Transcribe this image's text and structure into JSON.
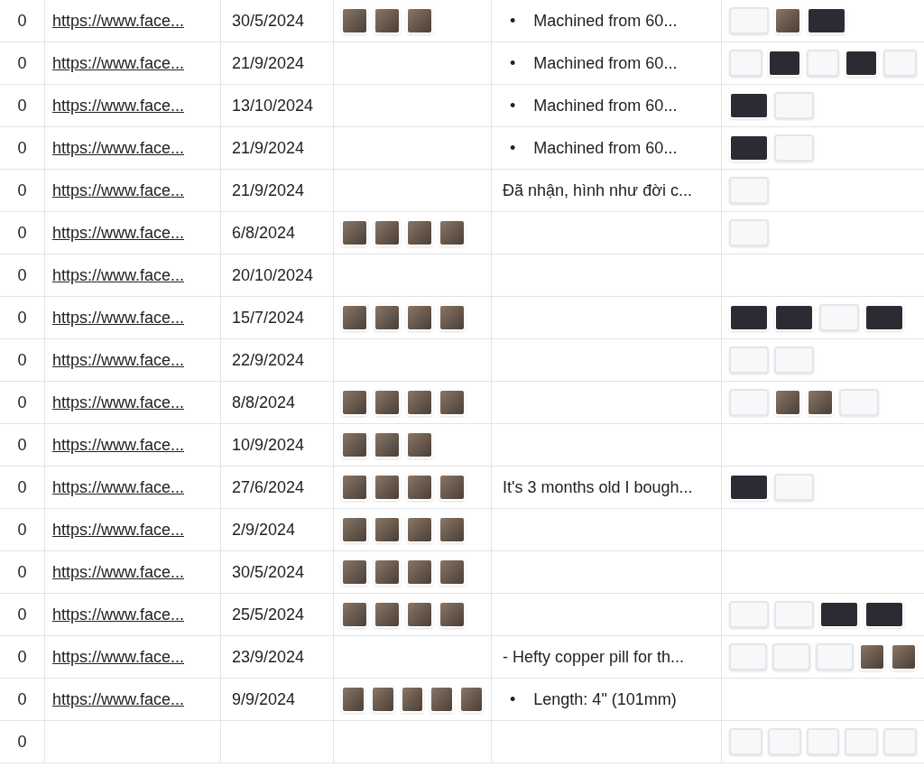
{
  "rows": [
    {
      "count": "0",
      "link": "https://www.face...",
      "date": "30/5/2024",
      "photos": [
        {
          "kind": "photo"
        },
        {
          "kind": "photo"
        },
        {
          "kind": "photo"
        }
      ],
      "bullet": "•",
      "text": "Machined from 60...",
      "attachments": [
        {
          "kind": "document"
        },
        {
          "kind": "photo"
        },
        {
          "kind": "dark"
        }
      ]
    },
    {
      "count": "0",
      "link": "https://www.face...",
      "date": "21/9/2024",
      "photos": [],
      "bullet": "•",
      "text": "Machined from 60...",
      "attachments": [
        {
          "kind": "document"
        },
        {
          "kind": "dark"
        },
        {
          "kind": "document"
        },
        {
          "kind": "dark"
        },
        {
          "kind": "document"
        }
      ]
    },
    {
      "count": "0",
      "link": "https://www.face...",
      "date": "13/10/2024",
      "photos": [],
      "bullet": "•",
      "text": "Machined from 60...",
      "attachments": [
        {
          "kind": "dark"
        },
        {
          "kind": "document"
        }
      ]
    },
    {
      "count": "0",
      "link": "https://www.face...",
      "date": "21/9/2024",
      "photos": [],
      "bullet": "•",
      "text": "Machined from 60...",
      "attachments": [
        {
          "kind": "dark"
        },
        {
          "kind": "document"
        }
      ]
    },
    {
      "count": "0",
      "link": "https://www.face...",
      "date": "21/9/2024",
      "photos": [],
      "text": "Đã nhận, hình như đời c...",
      "attachments": [
        {
          "kind": "document"
        }
      ]
    },
    {
      "count": "0",
      "link": "https://www.face...",
      "date": "6/8/2024",
      "photos": [
        {
          "kind": "photo"
        },
        {
          "kind": "photo"
        },
        {
          "kind": "photo"
        },
        {
          "kind": "photo"
        }
      ],
      "attachments": [
        {
          "kind": "document"
        }
      ]
    },
    {
      "count": "0",
      "link": "https://www.face...",
      "date": "20/10/2024",
      "photos": [],
      "attachments": []
    },
    {
      "count": "0",
      "link": "https://www.face...",
      "date": "15/7/2024",
      "photos": [
        {
          "kind": "photo"
        },
        {
          "kind": "photo"
        },
        {
          "kind": "photo"
        },
        {
          "kind": "photo"
        }
      ],
      "attachments": [
        {
          "kind": "dark"
        },
        {
          "kind": "dark"
        },
        {
          "kind": "document"
        },
        {
          "kind": "dark"
        }
      ]
    },
    {
      "count": "0",
      "link": "https://www.face...",
      "date": "22/9/2024",
      "photos": [],
      "attachments": [
        {
          "kind": "document"
        },
        {
          "kind": "document"
        }
      ]
    },
    {
      "count": "0",
      "link": "https://www.face...",
      "date": "8/8/2024",
      "photos": [
        {
          "kind": "photo"
        },
        {
          "kind": "photo"
        },
        {
          "kind": "photo"
        },
        {
          "kind": "photo"
        }
      ],
      "attachments": [
        {
          "kind": "document"
        },
        {
          "kind": "photo"
        },
        {
          "kind": "photo"
        },
        {
          "kind": "document"
        }
      ]
    },
    {
      "count": "0",
      "link": "https://www.face...",
      "date": "10/9/2024",
      "photos": [
        {
          "kind": "photo"
        },
        {
          "kind": "photo"
        },
        {
          "kind": "photo"
        }
      ],
      "attachments": []
    },
    {
      "count": "0",
      "link": "https://www.face...",
      "date": "27/6/2024",
      "photos": [
        {
          "kind": "photo"
        },
        {
          "kind": "photo"
        },
        {
          "kind": "photo"
        },
        {
          "kind": "photo"
        }
      ],
      "text": "It's 3 months old I bough...",
      "attachments": [
        {
          "kind": "dark"
        },
        {
          "kind": "document"
        }
      ]
    },
    {
      "count": "0",
      "link": "https://www.face...",
      "date": "2/9/2024",
      "photos": [
        {
          "kind": "photo"
        },
        {
          "kind": "photo"
        },
        {
          "kind": "photo"
        },
        {
          "kind": "photo"
        }
      ],
      "attachments": []
    },
    {
      "count": "0",
      "link": "https://www.face...",
      "date": "30/5/2024",
      "photos": [
        {
          "kind": "photo"
        },
        {
          "kind": "photo"
        },
        {
          "kind": "photo"
        },
        {
          "kind": "photo"
        }
      ],
      "attachments": []
    },
    {
      "count": "0",
      "link": "https://www.face...",
      "date": "25/5/2024",
      "photos": [
        {
          "kind": "photo"
        },
        {
          "kind": "photo"
        },
        {
          "kind": "photo"
        },
        {
          "kind": "photo"
        }
      ],
      "attachments": [
        {
          "kind": "document"
        },
        {
          "kind": "document"
        },
        {
          "kind": "dark"
        },
        {
          "kind": "dark"
        }
      ]
    },
    {
      "count": "0",
      "link": "https://www.face...",
      "date": "23/9/2024",
      "photos": [],
      "text": "- Hefty copper pill for th...",
      "attachments": [
        {
          "kind": "document"
        },
        {
          "kind": "document"
        },
        {
          "kind": "document"
        },
        {
          "kind": "photo"
        },
        {
          "kind": "photo"
        }
      ]
    },
    {
      "count": "0",
      "link": "https://www.face...",
      "date": "9/9/2024",
      "photos": [
        {
          "kind": "photo"
        },
        {
          "kind": "photo"
        },
        {
          "kind": "photo"
        },
        {
          "kind": "photo"
        },
        {
          "kind": "photo"
        }
      ],
      "bullet": "•",
      "text": "Length: 4\" (101mm)",
      "attachments": []
    },
    {
      "count": "0",
      "photos": [],
      "attachments": [
        {
          "kind": "document"
        },
        {
          "kind": "document"
        },
        {
          "kind": "document"
        },
        {
          "kind": "document"
        },
        {
          "kind": "document"
        }
      ]
    }
  ]
}
